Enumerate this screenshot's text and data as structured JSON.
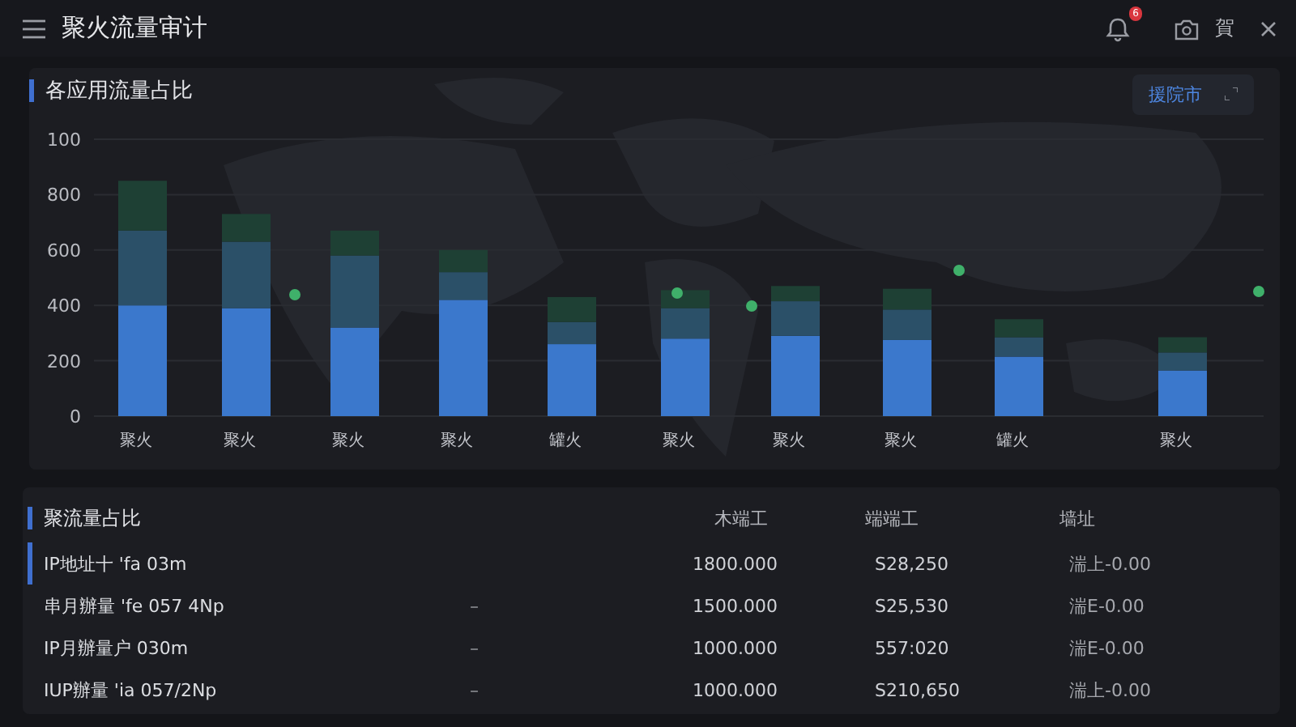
{
  "header": {
    "title": "聚火流量审计",
    "notification_count": "6",
    "user_label": "賀"
  },
  "app_chart": {
    "title": "各应用流量占比",
    "axis_top_label": "100",
    "filter_button": "援院市",
    "chart_data": {
      "type": "bar",
      "stacked": true,
      "grid": true,
      "categories": [
        "聚火",
        "聚火",
        "聚火",
        "聚火",
        "罐火",
        "聚火",
        "聚火",
        "聚火",
        "罐火",
        "聚火"
      ],
      "ylim": [
        0,
        1000
      ],
      "yticks": [
        0,
        200,
        400,
        600,
        800
      ],
      "series": [
        {
          "color": "#3b78cc",
          "values": [
            400,
            390,
            320,
            420,
            260,
            280,
            290,
            275,
            215,
            165
          ]
        },
        {
          "color": "#2b5068",
          "values": [
            270,
            240,
            260,
            100,
            80,
            110,
            125,
            110,
            70,
            65
          ]
        },
        {
          "color": "#1e4034",
          "values": [
            180,
            100,
            90,
            80,
            90,
            65,
            55,
            75,
            65,
            55
          ]
        }
      ]
    }
  },
  "table": {
    "title": "聚流量占比",
    "columns": [
      "木端工",
      "端端工",
      "墙址"
    ],
    "rows": [
      {
        "selected": true,
        "column_1": "IP地址十 'fa 03m",
        "column_3": "1800.000",
        "column_4": "S28,250",
        "column_5": "湍上-0.00"
      },
      {
        "selected": false,
        "column_1": "串月辦量 'fe 057 4Np",
        "column_2": "–",
        "column_3": "1500.000",
        "column_4": "S25,530",
        "column_5": "湍E-0.00"
      },
      {
        "selected": false,
        "column_1": "IP月辦量户 030m",
        "column_2": "–",
        "column_3": "1000.000",
        "column_4": "557:020",
        "column_5": "湍E-0.00"
      },
      {
        "selected": false,
        "column_1": "IUP辦量 'ia 057/2Np",
        "column_2": "–",
        "column_3": "1000.000",
        "column_4": "S210,650",
        "column_5": "湍上-0.00"
      }
    ]
  }
}
